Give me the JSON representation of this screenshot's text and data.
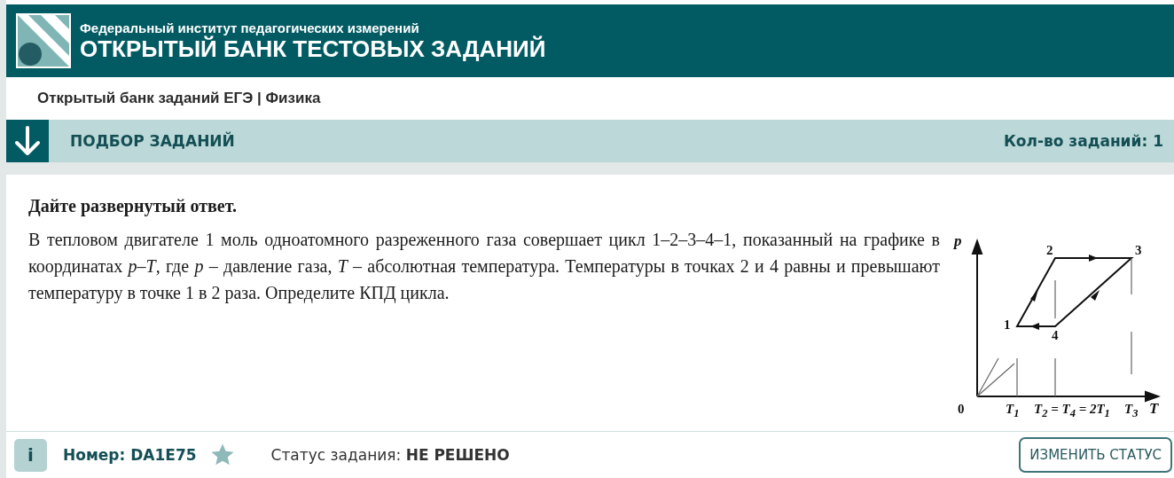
{
  "header": {
    "subtitle": "Федеральный институт педагогических измерений",
    "title": "ОТКРЫТЫЙ БАНК ТЕСТОВЫХ ЗАДАНИЙ"
  },
  "breadcrumb": "Открытый банк заданий ЕГЭ | Физика",
  "selection_bar": {
    "title": "ПОДБОР ЗАДАНИЙ",
    "count": "Кол-во заданий: 1"
  },
  "task": {
    "instruction": "Дайте развернутый ответ.",
    "text": "В тепловом двигателе 1 моль одноатомного разреженного газа совершает цикл 1–2–3–4–1, показанный на графике в координатах *p*–*T*, где *p* – давление газа, *T* – абсолютная температура. Температуры в точках 2 и 4 равны и превышают температуру в точке 1 в 2 раза. Определите КПД цикла.",
    "diagram_labels": [
      {
        "kind": "axis",
        "text": "p"
      },
      {
        "kind": "point",
        "text": "2"
      },
      {
        "kind": "point",
        "text": "3"
      },
      {
        "kind": "point",
        "text": "1"
      },
      {
        "kind": "point",
        "text": "4"
      },
      {
        "kind": "origin",
        "text": "0"
      },
      {
        "kind": "tick",
        "text": "T$_{1}$"
      },
      {
        "kind": "tick",
        "text": "T$_{2}$ = T$_{4}$ = 2T$_{1}$"
      },
      {
        "kind": "tick",
        "text": "T$_{3}$"
      },
      {
        "kind": "axis",
        "text": "T"
      }
    ]
  },
  "footer": {
    "info": "i",
    "number": "Номер: DA1E75",
    "favorite": false,
    "status_label": "Статус задания:",
    "status_value": "НЕ РЕШЕНО",
    "button": "ИЗМЕНИТЬ СТАТУС"
  }
}
